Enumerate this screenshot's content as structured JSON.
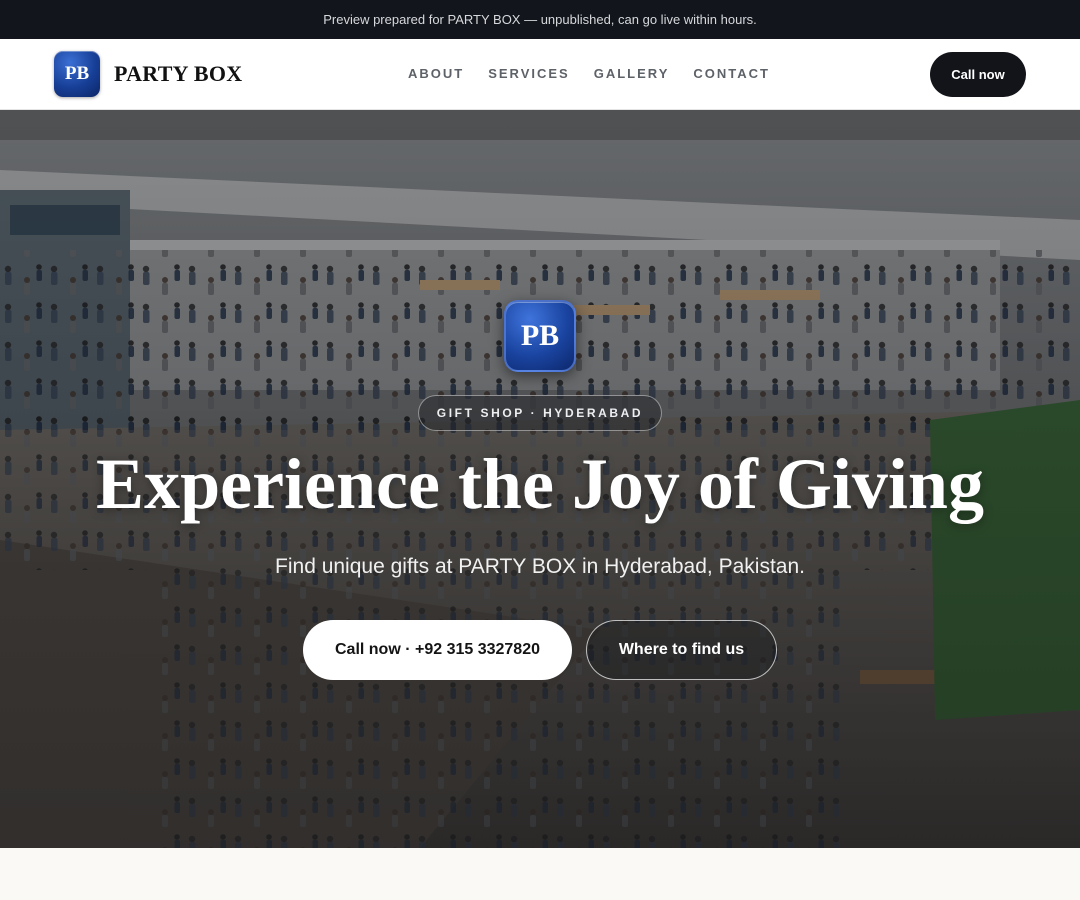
{
  "preview_bar": {
    "text": "Preview prepared for PARTY BOX — unpublished, can go live within hours."
  },
  "header": {
    "logo_initials": "PB",
    "brand_name": "PARTY BOX",
    "nav": [
      {
        "label": "ABOUT"
      },
      {
        "label": "SERVICES"
      },
      {
        "label": "GALLERY"
      },
      {
        "label": "CONTACT"
      }
    ],
    "call_button": "Call now"
  },
  "hero": {
    "logo_initials": "PB",
    "eyebrow": "GIFT SHOP · HYDERABAD",
    "title": "Experience the Joy of Giving",
    "subtitle": "Find unique gifts at PARTY BOX in Hyderabad, Pakistan.",
    "primary_button": "Call now · +92 315 3327820",
    "secondary_button": "Where to find us"
  },
  "colors": {
    "preview_bar_bg": "#12151b",
    "header_bg": "#ffffff",
    "logo_blue": "#173f97",
    "call_button_bg": "#12141a",
    "page_bg": "#faf9f6"
  },
  "icons": {
    "hero_background": "shopping-mall-photo"
  }
}
